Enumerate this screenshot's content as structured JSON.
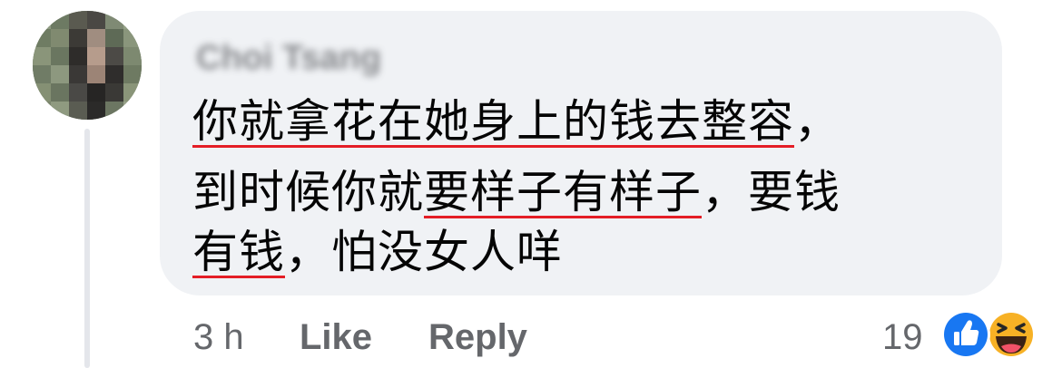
{
  "comment": {
    "author": "Choi Tsang",
    "lines": [
      {
        "underlined": "你就拿花在她身上的钱去整容",
        "after": "，"
      },
      {
        "before": "到时候你就",
        "underlined": "要样子有样子",
        "after": "，要钱"
      },
      {
        "underlined": "有钱",
        "after": "，怕没女人咩"
      }
    ],
    "timestamp": "3 h",
    "like_label": "Like",
    "reply_label": "Reply",
    "reaction_count": "19",
    "reactions": [
      "like-icon",
      "haha-icon"
    ]
  },
  "colors": {
    "bubble": "#f0f2f5",
    "underline": "#e41e26",
    "like_blue": "#1877f2",
    "haha_yellow": "#f7b125",
    "meta_text": "#65676b"
  }
}
